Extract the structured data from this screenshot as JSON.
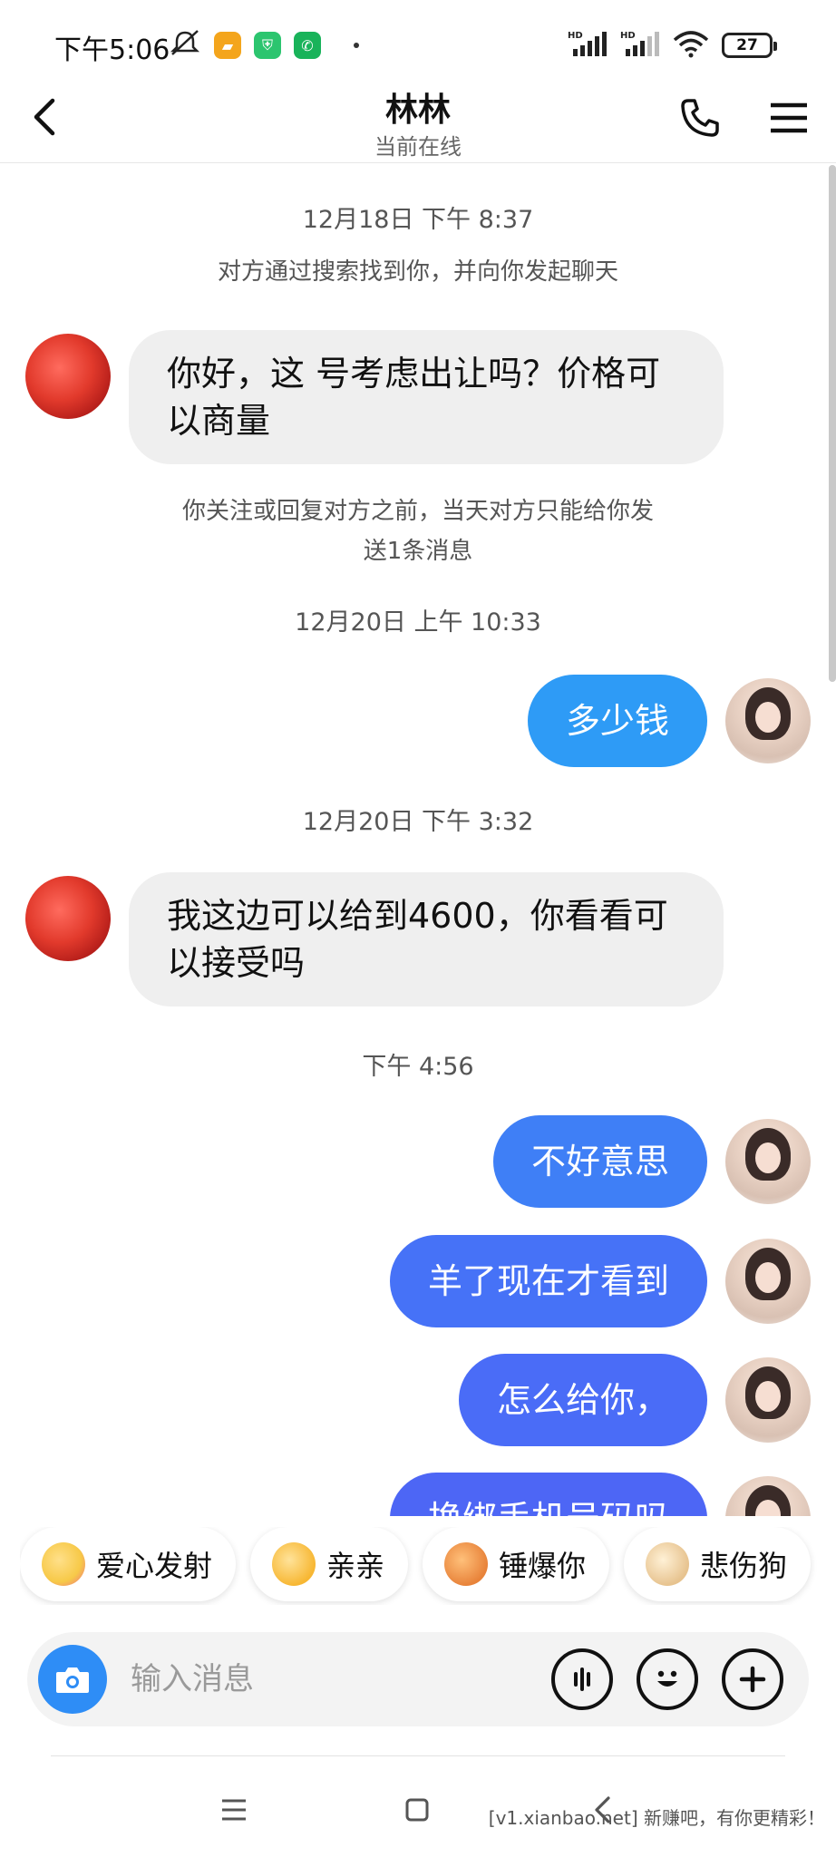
{
  "status_bar": {
    "time": "下午5:06",
    "battery": "27",
    "network_label_1": "HD",
    "network_label_2": "HD",
    "app_colors": [
      "#f4a51c",
      "#2cc56f",
      "#19b35a"
    ]
  },
  "header": {
    "title": "林林",
    "subtitle": "当前在线"
  },
  "messages": {
    "ts1": "12月18日 下午 8:37",
    "sys1": "对方通过搜索找到你，并向你发起聊天",
    "in1": "你好，这 号考虑出让吗？价格可以商量",
    "sys2": "你关注或回复对方之前，当天对方只能给你发送1条消息",
    "ts2": "12月20日 上午 10:33",
    "out1": "多少钱",
    "ts3": "12月20日 下午 3:32",
    "in2": "我这边可以给到4600，你看看可以接受吗",
    "ts4": "下午 4:56",
    "out2": "不好意思",
    "out3": "羊了现在才看到",
    "out4": "怎么给你，",
    "out5": "换绑手机号码吗"
  },
  "stickers": [
    {
      "label": "爱心发射",
      "icon": "heart-emoji-icon",
      "color": "#f7c948"
    },
    {
      "label": "亲亲",
      "icon": "kiss-emoji-icon",
      "color": "#f7b733"
    },
    {
      "label": "锤爆你",
      "icon": "hammer-icon",
      "color": "#e8833a"
    },
    {
      "label": "悲伤狗",
      "icon": "sad-dog-icon",
      "color": "#e7c38f"
    }
  ],
  "input": {
    "placeholder": "输入消息"
  },
  "colors": {
    "out_bubble_1": "#2e9bf6",
    "out_bubble_2": "#4a6cf7",
    "camera_button": "#2e8df6"
  },
  "watermark": "[v1.xianbao.net] 新赚吧，有你更精彩！"
}
